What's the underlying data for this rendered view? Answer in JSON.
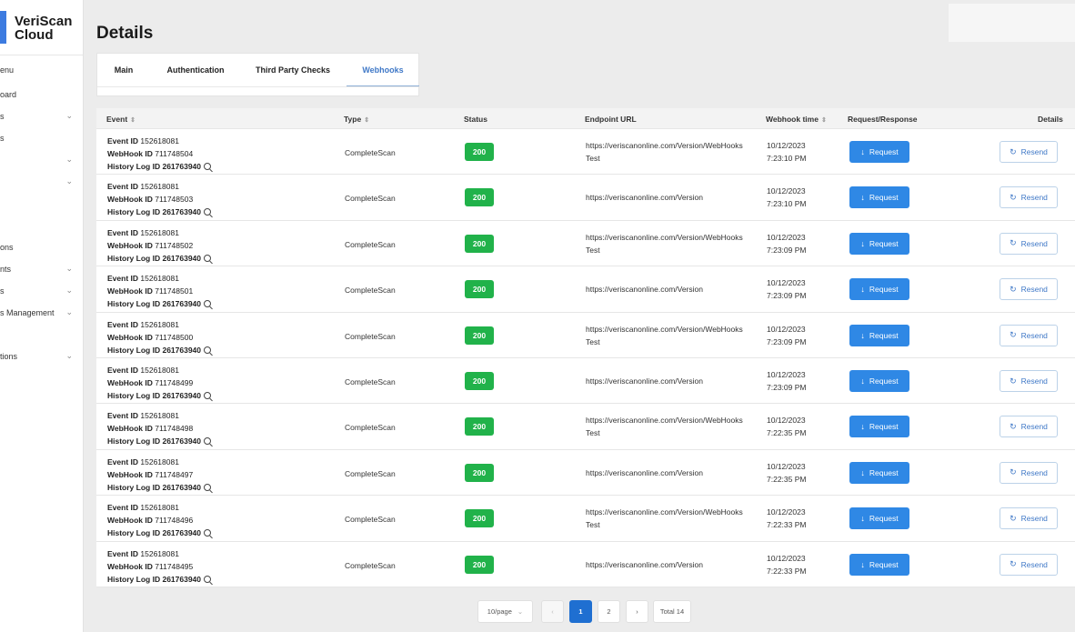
{
  "app": {
    "brand_line1": "VeriScan",
    "brand_line2": "Cloud"
  },
  "sidebar": {
    "items": [
      {
        "label": "enu",
        "chevron": ""
      },
      {
        "label": "oard",
        "chevron": ""
      },
      {
        "label": "s",
        "chevron": "⌄"
      },
      {
        "label": "s",
        "chevron": ""
      },
      {
        "label": "",
        "chevron": "⌄"
      },
      {
        "label": "",
        "chevron": "⌄"
      },
      {
        "label": "ons",
        "chevron": ""
      },
      {
        "label": "nts",
        "chevron": "⌄"
      },
      {
        "label": "s",
        "chevron": "⌄"
      },
      {
        "label": "s Management",
        "chevron": "⌄"
      },
      {
        "label": "tions",
        "chevron": "⌄"
      }
    ]
  },
  "page": {
    "title": "Details"
  },
  "tabs": [
    {
      "label": "Main",
      "active": false
    },
    {
      "label": "Authentication",
      "active": false
    },
    {
      "label": "Third Party Checks",
      "active": false
    },
    {
      "label": "Webhooks",
      "active": true
    }
  ],
  "table": {
    "headers": {
      "event": "Event",
      "type": "Type",
      "status": "Status",
      "endpoint": "Endpoint URL",
      "webhook_time": "Webhook time",
      "req_resp": "Request/Response",
      "details": "Details"
    },
    "labels": {
      "event_id": "Event ID",
      "webhook_id": "WebHook ID",
      "history_log_id": "History Log ID",
      "request": "Request",
      "resend": "Resend"
    },
    "rows": [
      {
        "event_id": "152618081",
        "webhook_id": "711748504",
        "history_id": "261763940",
        "type": "CompleteScan",
        "status": "200",
        "url1": "https://veriscanonline.com/Version/WebHooks",
        "url2": "Test",
        "date": "10/12/2023",
        "time": "7:23:10 PM"
      },
      {
        "event_id": "152618081",
        "webhook_id": "711748503",
        "history_id": "261763940",
        "type": "CompleteScan",
        "status": "200",
        "url1": "https://veriscanonline.com/Version",
        "url2": "",
        "date": "10/12/2023",
        "time": "7:23:10 PM"
      },
      {
        "event_id": "152618081",
        "webhook_id": "711748502",
        "history_id": "261763940",
        "type": "CompleteScan",
        "status": "200",
        "url1": "https://veriscanonline.com/Version/WebHooks",
        "url2": "Test",
        "date": "10/12/2023",
        "time": "7:23:09 PM"
      },
      {
        "event_id": "152618081",
        "webhook_id": "711748501",
        "history_id": "261763940",
        "type": "CompleteScan",
        "status": "200",
        "url1": "https://veriscanonline.com/Version",
        "url2": "",
        "date": "10/12/2023",
        "time": "7:23:09 PM"
      },
      {
        "event_id": "152618081",
        "webhook_id": "711748500",
        "history_id": "261763940",
        "type": "CompleteScan",
        "status": "200",
        "url1": "https://veriscanonline.com/Version/WebHooks",
        "url2": "Test",
        "date": "10/12/2023",
        "time": "7:23:09 PM"
      },
      {
        "event_id": "152618081",
        "webhook_id": "711748499",
        "history_id": "261763940",
        "type": "CompleteScan",
        "status": "200",
        "url1": "https://veriscanonline.com/Version",
        "url2": "",
        "date": "10/12/2023",
        "time": "7:23:09 PM"
      },
      {
        "event_id": "152618081",
        "webhook_id": "711748498",
        "history_id": "261763940",
        "type": "CompleteScan",
        "status": "200",
        "url1": "https://veriscanonline.com/Version/WebHooks",
        "url2": "Test",
        "date": "10/12/2023",
        "time": "7:22:35 PM"
      },
      {
        "event_id": "152618081",
        "webhook_id": "711748497",
        "history_id": "261763940",
        "type": "CompleteScan",
        "status": "200",
        "url1": "https://veriscanonline.com/Version",
        "url2": "",
        "date": "10/12/2023",
        "time": "7:22:35 PM"
      },
      {
        "event_id": "152618081",
        "webhook_id": "711748496",
        "history_id": "261763940",
        "type": "CompleteScan",
        "status": "200",
        "url1": "https://veriscanonline.com/Version/WebHooks",
        "url2": "Test",
        "date": "10/12/2023",
        "time": "7:22:33 PM"
      },
      {
        "event_id": "152618081",
        "webhook_id": "711748495",
        "history_id": "261763940",
        "type": "CompleteScan",
        "status": "200",
        "url1": "https://veriscanonline.com/Version",
        "url2": "",
        "date": "10/12/2023",
        "time": "7:22:33 PM"
      }
    ]
  },
  "pagination": {
    "page_size": "10/page",
    "prev": "‹",
    "pages": [
      "1",
      "2"
    ],
    "current": "1",
    "next": "›",
    "total": "Total 14"
  },
  "icons": {
    "sort": "sort-icon",
    "search": "search-icon",
    "request": "arrow-down-icon",
    "resend": "refresh-icon"
  },
  "colors": {
    "accent": "#2f88e5",
    "success": "#21b24a",
    "active_page": "#1f6fd1"
  }
}
